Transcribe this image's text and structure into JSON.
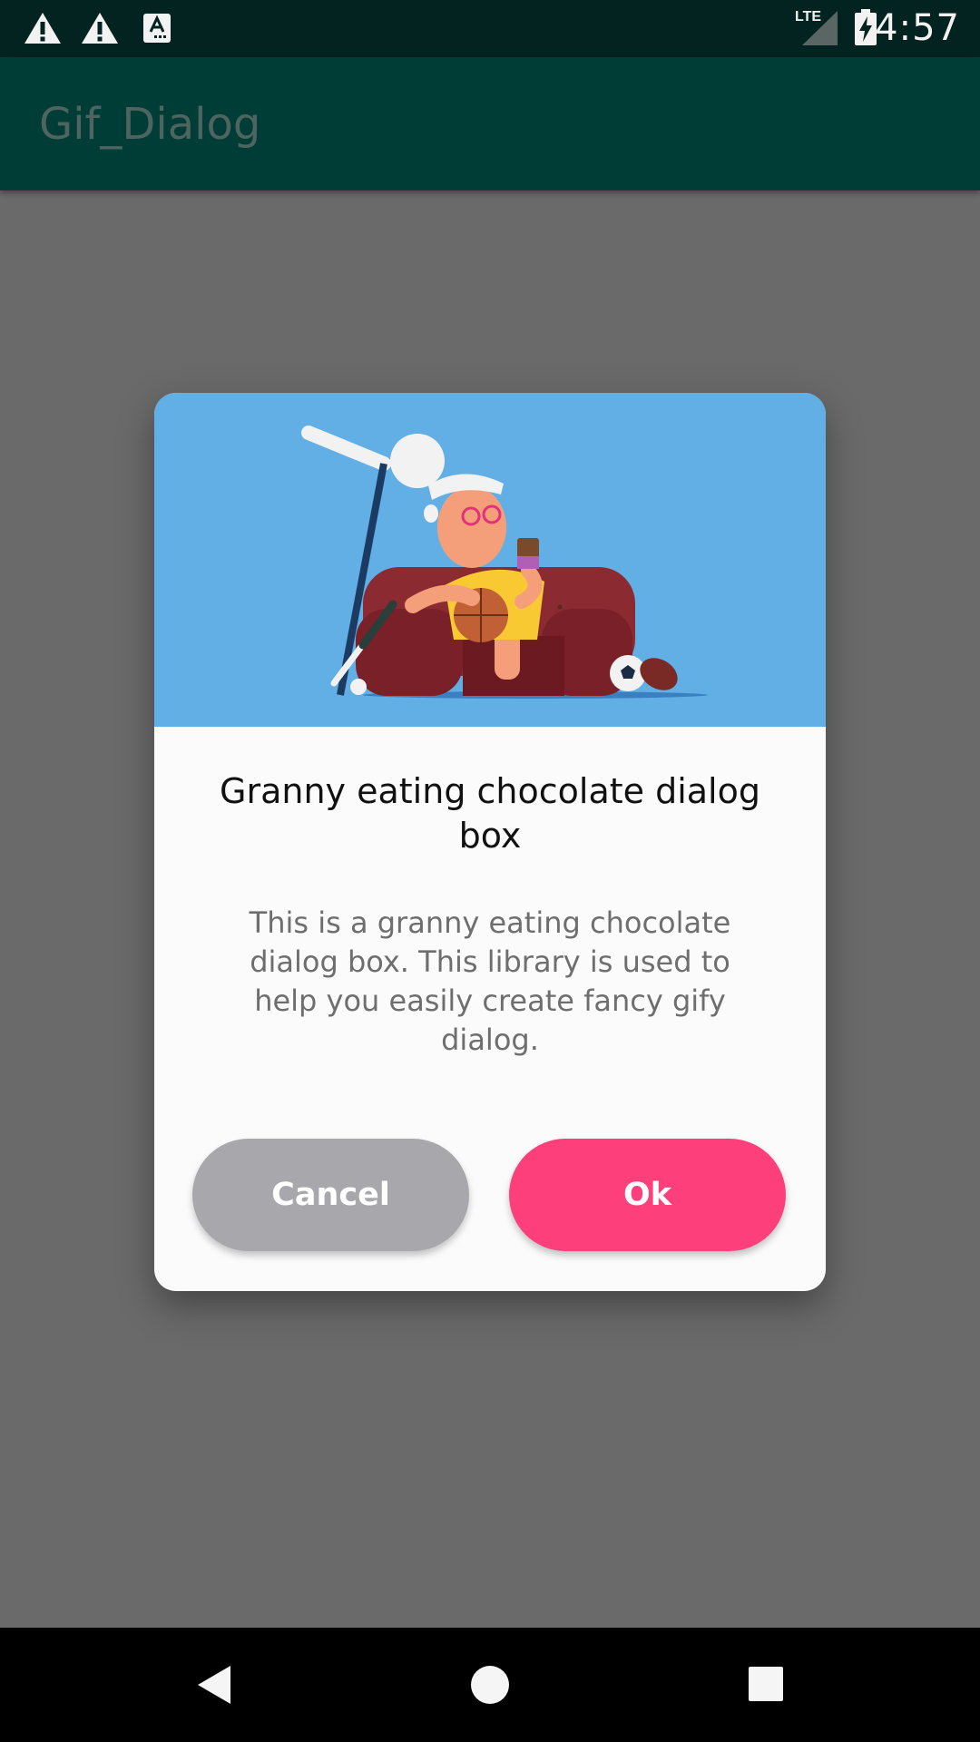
{
  "status_bar": {
    "time": "4:57",
    "icons": [
      "warning-icon",
      "warning-icon",
      "keyboard-a-icon",
      "lte-signal-icon",
      "battery-charging-icon"
    ],
    "network_label": "LTE"
  },
  "app_bar": {
    "title": "Gif_Dialog"
  },
  "dialog": {
    "image_name": "granny-eating-chocolate-illustration",
    "title": "Granny eating chocolate dialog box",
    "message": "This is a granny eating chocolate dialog box. This library is used to help you easily create fancy gify dialog.",
    "cancel_label": "Cancel",
    "ok_label": "Ok",
    "colors": {
      "image_background": "#61afe5",
      "cancel_button": "#a8a7ab",
      "ok_button": "#fd407b"
    }
  },
  "nav_bar": {
    "icons": [
      "back-icon",
      "home-icon",
      "recents-icon"
    ]
  }
}
